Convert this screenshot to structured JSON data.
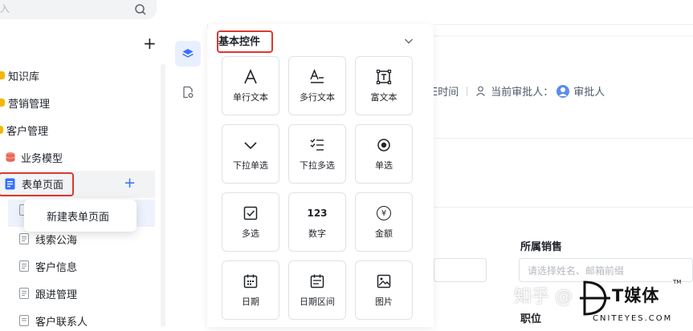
{
  "sidebar": {
    "search_placeholder": "入",
    "items": [
      {
        "label": "知识库"
      },
      {
        "label": "营销管理"
      },
      {
        "label": "客户管理"
      },
      {
        "label": "业务模型"
      },
      {
        "label": "表单页面"
      },
      {
        "label": "线索公海"
      },
      {
        "label": "客户信息"
      },
      {
        "label": "跟进管理"
      },
      {
        "label": "客户联系人"
      }
    ],
    "popup_label": "新建表单页面"
  },
  "panel": {
    "title": "基本控件",
    "components": [
      {
        "label": "单行文本",
        "icon": "text-a-icon"
      },
      {
        "label": "多行文本",
        "icon": "multiline-text-icon"
      },
      {
        "label": "富文本",
        "icon": "rich-text-icon"
      },
      {
        "label": "下拉单选",
        "icon": "chevron-down-icon"
      },
      {
        "label": "下拉多选",
        "icon": "checklist-icon"
      },
      {
        "label": "单选",
        "icon": "radio-icon"
      },
      {
        "label": "多选",
        "icon": "checkbox-icon"
      },
      {
        "label": "数字",
        "icon": "number-icon",
        "glyph": "123"
      },
      {
        "label": "金额",
        "icon": "yen-icon",
        "glyph": "¥"
      },
      {
        "label": "日期",
        "icon": "calendar-icon"
      },
      {
        "label": "日期区间",
        "icon": "date-range-icon"
      },
      {
        "label": "图片",
        "icon": "image-icon"
      }
    ]
  },
  "page": {
    "meta_time": "E时间",
    "meta_approver_label": "当前审批人：",
    "meta_approver_value": "审批人",
    "field_sales_label": "所属销售",
    "field_sales_placeholder": "请选择姓名、邮箱前缀",
    "field_position_label": "职位"
  },
  "watermark": {
    "text": "知乎 @",
    "brand": "T媒体",
    "sub": "CNITEYES.COM",
    "tm": "TM"
  },
  "colors": {
    "accent": "#3370ff",
    "highlight": "#d93a2f",
    "folder": "#f5b700"
  }
}
